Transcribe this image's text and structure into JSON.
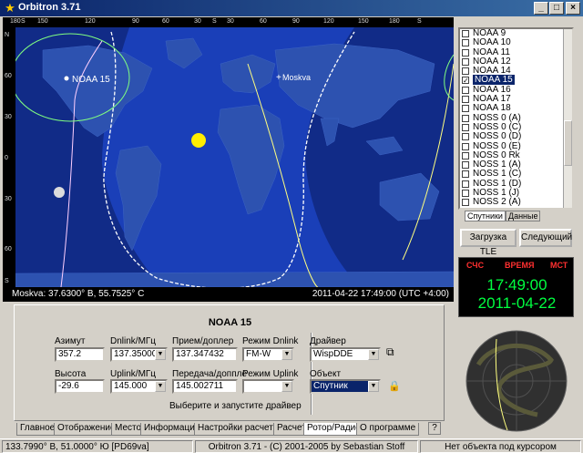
{
  "window": {
    "title": "Orbitron 3.71",
    "minimize": "_",
    "maximize": "□",
    "close": "×"
  },
  "map": {
    "lon_ticks": [
      "180",
      "S",
      "150",
      "120",
      "90",
      "60",
      "30",
      "S",
      "30",
      "60",
      "90",
      "120",
      "150",
      "180",
      "S"
    ],
    "lat_ticks": [
      "N",
      "60",
      "30",
      "0",
      "30",
      "60",
      "S"
    ],
    "satellite_label": "NOAA 15",
    "station_label": "Moskva",
    "status_left": "Moskva: 37.6300° В, 55.7525° С",
    "status_right": "2011-04-22 17:49:00 (UTC +4:00)",
    "colors": {
      "ocean": "#1a3fb8",
      "land": "#2b4fa8",
      "night": "#112a86",
      "footprint": "#ffffff",
      "track": "#ffff80",
      "sun": "#ffee00"
    }
  },
  "satellite_list": [
    {
      "name": "NOAA 9",
      "checked": false
    },
    {
      "name": "NOAA 10",
      "checked": false
    },
    {
      "name": "NOAA 11",
      "checked": false
    },
    {
      "name": "NOAA 12",
      "checked": false
    },
    {
      "name": "NOAA 14",
      "checked": false
    },
    {
      "name": "NOAA 15",
      "checked": true
    },
    {
      "name": "NOAA 16",
      "checked": false
    },
    {
      "name": "NOAA 17",
      "checked": false
    },
    {
      "name": "NOAA 18",
      "checked": false
    },
    {
      "name": "NOSS 0 (A)",
      "checked": false
    },
    {
      "name": "NOSS 0 (C)",
      "checked": false
    },
    {
      "name": "NOSS 0 (D)",
      "checked": false
    },
    {
      "name": "NOSS 0 (E)",
      "checked": false
    },
    {
      "name": "NOSS 0 Rk",
      "checked": false
    },
    {
      "name": "NOSS 1 (A)",
      "checked": false
    },
    {
      "name": "NOSS 1 (C)",
      "checked": false
    },
    {
      "name": "NOSS 1 (D)",
      "checked": false
    },
    {
      "name": "NOSS 1 (J)",
      "checked": false
    },
    {
      "name": "NOSS 2 (A)",
      "checked": false
    }
  ],
  "list_tabs": {
    "satellites": "Спутники",
    "data": "Данные"
  },
  "buttons": {
    "load_tle": "Загрузка TLE",
    "next": "Следующий"
  },
  "clock": {
    "tz_utc": "СЧС",
    "tz_local": "ВРЕМЯ",
    "tz_dst": "МСТ",
    "time": "17:49:00",
    "date": "2011-04-22"
  },
  "panel": {
    "title": "NOAA 15",
    "azimuth_label": "Азимут",
    "azimuth_value": "357.2",
    "dnlink_label": "Dnlink/МГц",
    "dnlink_value": "137.350000",
    "rx_doppler_label": "Прием/доплер",
    "rx_doppler_value": "137.347432",
    "dnlink_mode_label": "Режим Dnlink",
    "dnlink_mode_value": "FM-W",
    "driver_label": "Драйвер",
    "driver_value": "WispDDE",
    "elevation_label": "Высота",
    "elevation_value": "-29.6",
    "uplink_label": "Uplink/МГц",
    "uplink_value": "145.000",
    "tx_doppler_label": "Передача/доппле",
    "tx_doppler_value": "145.002711",
    "uplink_mode_label": "Режим Uplink",
    "uplink_mode_value": "",
    "object_label": "Объект",
    "object_value": "Спутник",
    "hint": "Выберите и запустите драйвер"
  },
  "tabs": [
    {
      "label": "Главное",
      "active": false
    },
    {
      "label": "Отображение",
      "active": false
    },
    {
      "label": "Место",
      "active": false
    },
    {
      "label": "Информация",
      "active": false
    },
    {
      "label": "Настройки расчета",
      "active": false
    },
    {
      "label": "Расчет",
      "active": false
    },
    {
      "label": "Ротор/Радио",
      "active": true
    },
    {
      "label": "О программе",
      "active": false
    }
  ],
  "help": "?",
  "statusbar": {
    "coords": "133.7990° В, 51.0000° Ю [PD69va]",
    "copyright": "Orbitron 3.71 - (C) 2001-2005 by Sebastian Stoff",
    "cursor_info": "Нет объекта под курсором"
  }
}
